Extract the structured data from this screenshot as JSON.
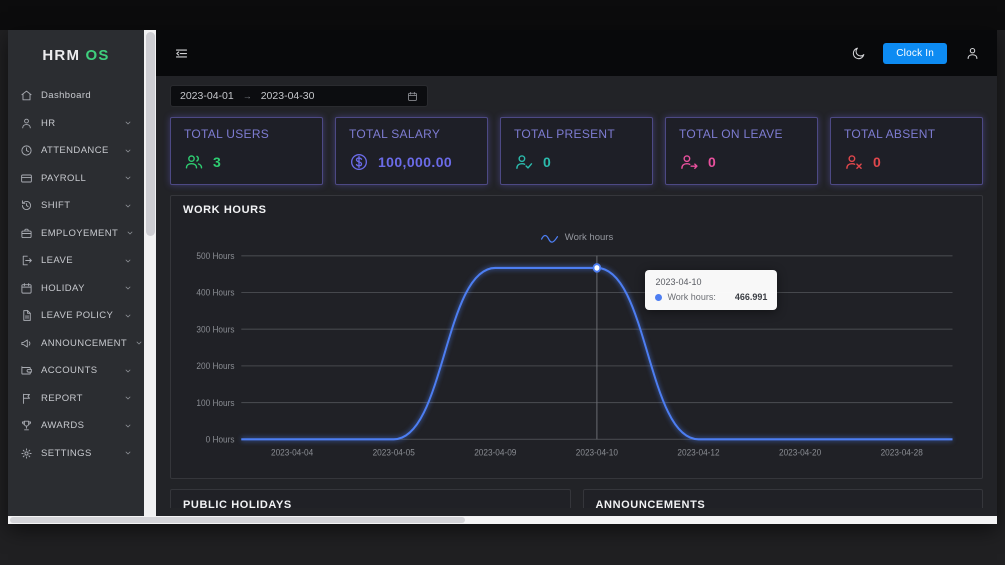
{
  "sidebar": {
    "logo": {
      "primary": "HRM",
      "accent": "OS",
      "accent_color": "#3fcf7d"
    },
    "items": [
      {
        "label": "Dashboard",
        "icon": "home-icon",
        "expandable": false
      },
      {
        "label": "HR",
        "icon": "user-icon",
        "expandable": true
      },
      {
        "label": "ATTENDANCE",
        "icon": "clock-icon",
        "expandable": true
      },
      {
        "label": "PAYROLL",
        "icon": "credit-card-icon",
        "expandable": true
      },
      {
        "label": "SHIFT",
        "icon": "time-icon",
        "expandable": true
      },
      {
        "label": "EMPLOYEMENT",
        "icon": "briefcase-icon",
        "expandable": true
      },
      {
        "label": "LEAVE",
        "icon": "leave-icon",
        "expandable": true
      },
      {
        "label": "HOLIDAY",
        "icon": "calendar-icon",
        "expandable": true
      },
      {
        "label": "LEAVE POLICY",
        "icon": "document-icon",
        "expandable": true
      },
      {
        "label": "ANNOUNCEMENT",
        "icon": "megaphone-icon",
        "expandable": true
      },
      {
        "label": "ACCOUNTS",
        "icon": "wallet-icon",
        "expandable": true
      },
      {
        "label": "REPORT",
        "icon": "report-icon",
        "expandable": true
      },
      {
        "label": "AWARDS",
        "icon": "award-icon",
        "expandable": true
      },
      {
        "label": "SETTINGS",
        "icon": "gear-icon",
        "expandable": true
      }
    ]
  },
  "topbar": {
    "clock_in_label": "Clock In"
  },
  "filters": {
    "date_start": "2023-04-01",
    "date_end": "2023-04-30"
  },
  "stats": [
    {
      "title": "TOTAL USERS",
      "value": "3",
      "icon": "users-icon",
      "color": "#2ecc71"
    },
    {
      "title": "TOTAL SALARY",
      "value": "100,000.00",
      "icon": "dollar-circle-icon",
      "color": "#6b6be8"
    },
    {
      "title": "TOTAL PRESENT",
      "value": "0",
      "icon": "user-check-icon",
      "color": "#2bbbad"
    },
    {
      "title": "TOTAL ON LEAVE",
      "value": "0",
      "icon": "user-leave-icon",
      "color": "#e8509d"
    },
    {
      "title": "TOTAL ABSENT",
      "value": "0",
      "icon": "user-x-icon",
      "color": "#e0474c"
    }
  ],
  "chart_data": {
    "type": "line",
    "title": "WORK HOURS",
    "legend": [
      {
        "label": "Work hours",
        "color": "#4d7ef2"
      }
    ],
    "categories": [
      "2023-04-04",
      "2023-04-05",
      "2023-04-09",
      "2023-04-10",
      "2023-04-12",
      "2023-04-20",
      "2023-04-28"
    ],
    "series": [
      {
        "name": "Work hours",
        "values": [
          0,
          0,
          466.991,
          466.991,
          0,
          0,
          0
        ]
      }
    ],
    "ylim": [
      0,
      500
    ],
    "ytick_step": 100,
    "ytick_labels": [
      "0 Hours",
      "100 Hours",
      "200 Hours",
      "300 Hours",
      "400 Hours",
      "500 Hours"
    ],
    "grid": true,
    "line_color": "#4d7ef2",
    "smooth": true,
    "tooltip": {
      "title": "2023-04-10",
      "series": "Work hours:",
      "value": "466.991",
      "marker_index": 3
    }
  },
  "panels": {
    "public_holidays": "PUBLIC HOLIDAYS",
    "announcements": "ANNOUNCEMENTS"
  }
}
